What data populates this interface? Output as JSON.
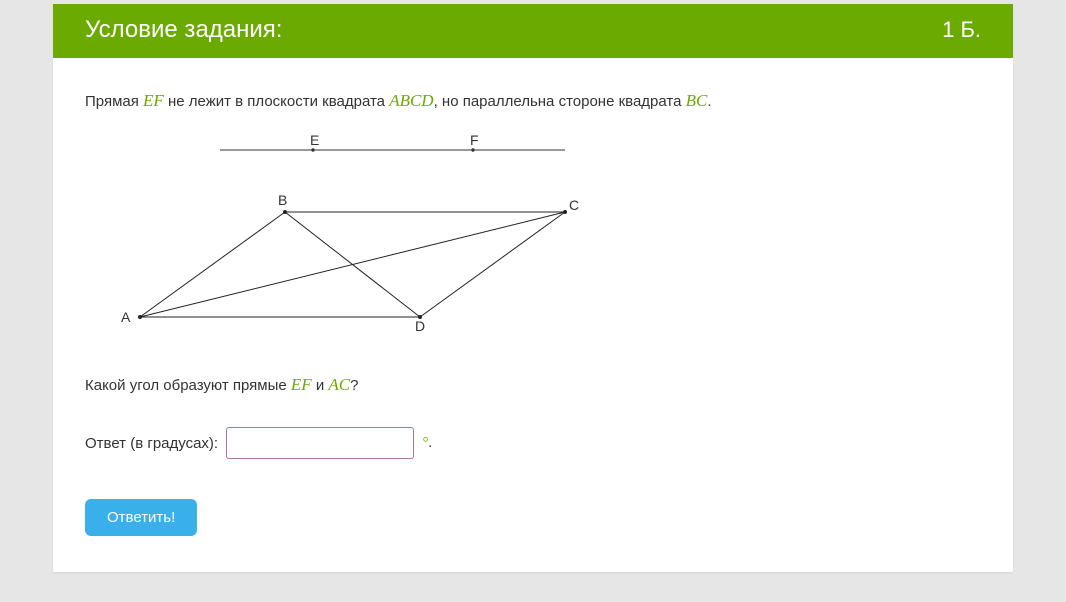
{
  "header": {
    "title": "Условие задания:",
    "score": "1 Б."
  },
  "problem": {
    "line1_pre": "Прямая ",
    "var_EF": "EF",
    "line1_mid": " не лежит в плоскости квадрата ",
    "var_ABCD": "ABCD",
    "line1_mid2": ", но параллельна стороне квадрата ",
    "var_BC": "BC",
    "line1_end": "."
  },
  "figure": {
    "labels": {
      "A": "A",
      "B": "B",
      "C": "C",
      "D": "D",
      "E": "E",
      "F": "F"
    }
  },
  "question": {
    "pre": "Какой угол образуют прямые ",
    "var_EF": "EF",
    "mid": " и ",
    "var_AC": "AC",
    "end": "?"
  },
  "answer": {
    "label": "Ответ (в градусах): ",
    "deg": "°",
    "dot": "."
  },
  "submit": {
    "label": "Ответить!"
  }
}
